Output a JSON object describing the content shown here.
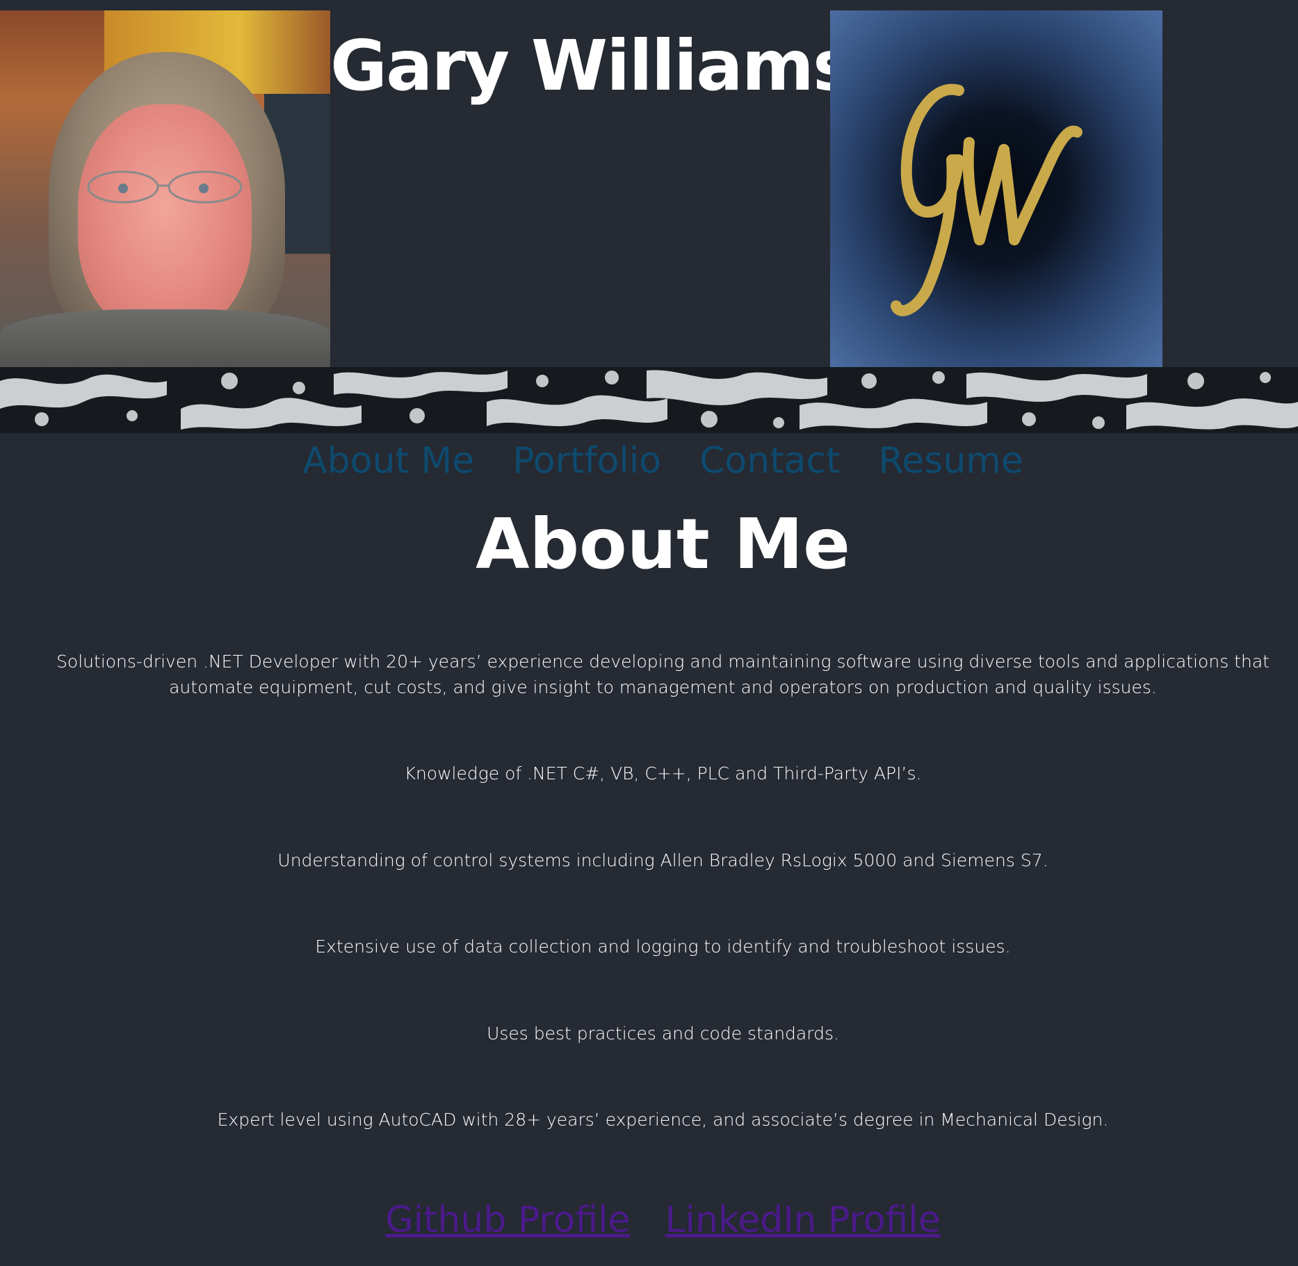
{
  "header": {
    "name": "Gary Williams",
    "logo_monogram": "GW",
    "portrait_icon": "profile-photo",
    "logo_icon": "gw-monogram-logo"
  },
  "nav": {
    "items": [
      {
        "label": "About Me"
      },
      {
        "label": "Portfolio"
      },
      {
        "label": "Contact"
      },
      {
        "label": "Resume"
      }
    ]
  },
  "about": {
    "title": "About Me",
    "paragraphs": [
      "Solutions-driven .NET Developer with 20+ years’ experience developing and maintaining software using diverse tools and applications that automate equipment, cut costs, and give insight to management and operators on production and quality issues.",
      "Knowledge of .NET C#, VB, C++, PLC and Third-Party API’s.",
      "Understanding of control systems including Allen Bradley RsLogix 5000 and Siemens S7.",
      "Extensive use of data collection and logging to identify and troubleshoot issues.",
      "Uses best practices and code standards.",
      "Expert level using AutoCAD with 28+ years’ experience, and associate’s degree in Mechanical Design."
    ]
  },
  "profile_links": {
    "github": "Github Profile",
    "linkedin": "LinkedIn Profile"
  },
  "colors": {
    "background": "#252a33",
    "nav_link": "#0e4a6e",
    "visited_link": "#4b1a8a",
    "logo_gold": "#c9a94a",
    "logo_blue": "#4d6ea3"
  }
}
